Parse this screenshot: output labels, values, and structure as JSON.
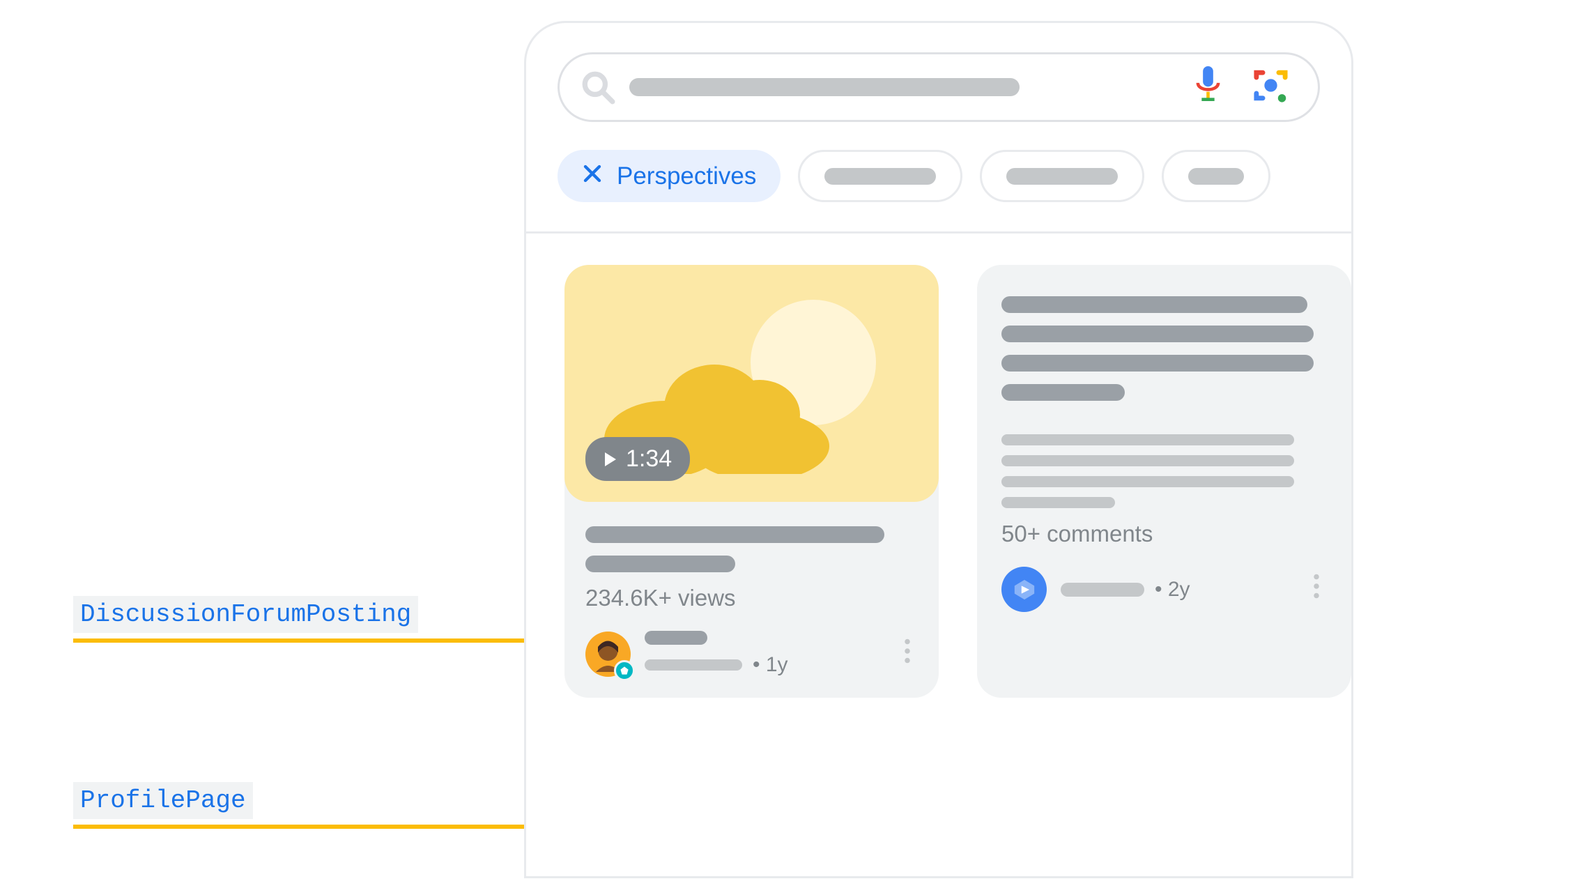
{
  "annotations": {
    "discussion": "DiscussionForumPosting",
    "profile": "ProfilePage"
  },
  "chips": {
    "active_label": "Perspectives"
  },
  "video_card": {
    "duration": "1:34",
    "views": "234.6K+ views",
    "time_ago": "1y"
  },
  "text_card": {
    "comments": "50+ comments",
    "time_ago": "2y"
  }
}
